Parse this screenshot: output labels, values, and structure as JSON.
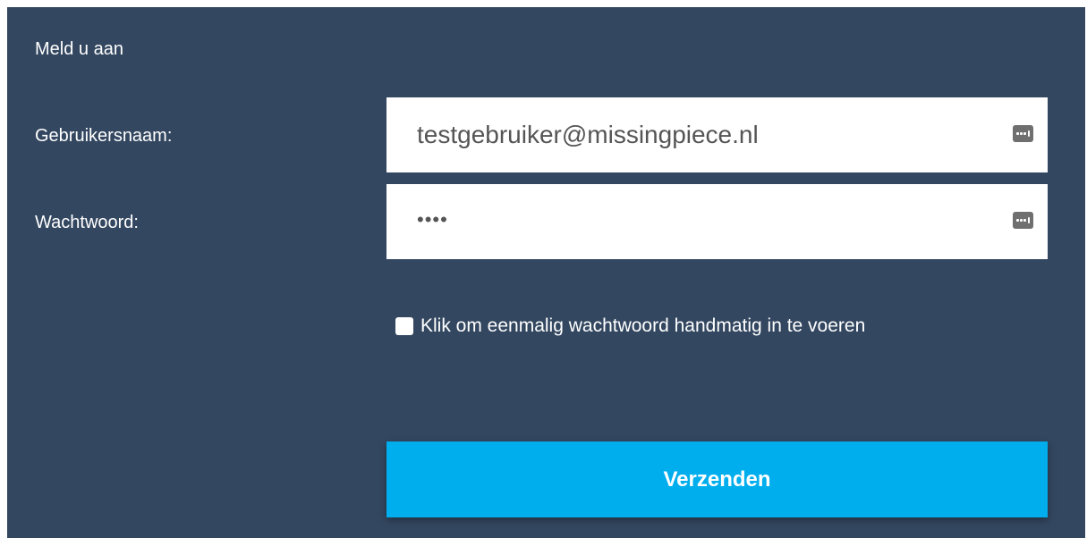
{
  "form": {
    "title": "Meld u aan",
    "username": {
      "label": "Gebruikersnaam:",
      "value": "testgebruiker@missingpiece.nl",
      "icon": "password-manager-icon"
    },
    "password": {
      "label": "Wachtwoord:",
      "value": "••••",
      "icon": "password-manager-icon"
    },
    "otp_checkbox": {
      "label": "Klik om eenmalig wachtwoord handmatig in te voeren",
      "checked": false
    },
    "submit_label": "Verzenden"
  },
  "colors": {
    "panel_background": "#334760",
    "submit_background": "#00aeee",
    "text": "#ffffff"
  }
}
